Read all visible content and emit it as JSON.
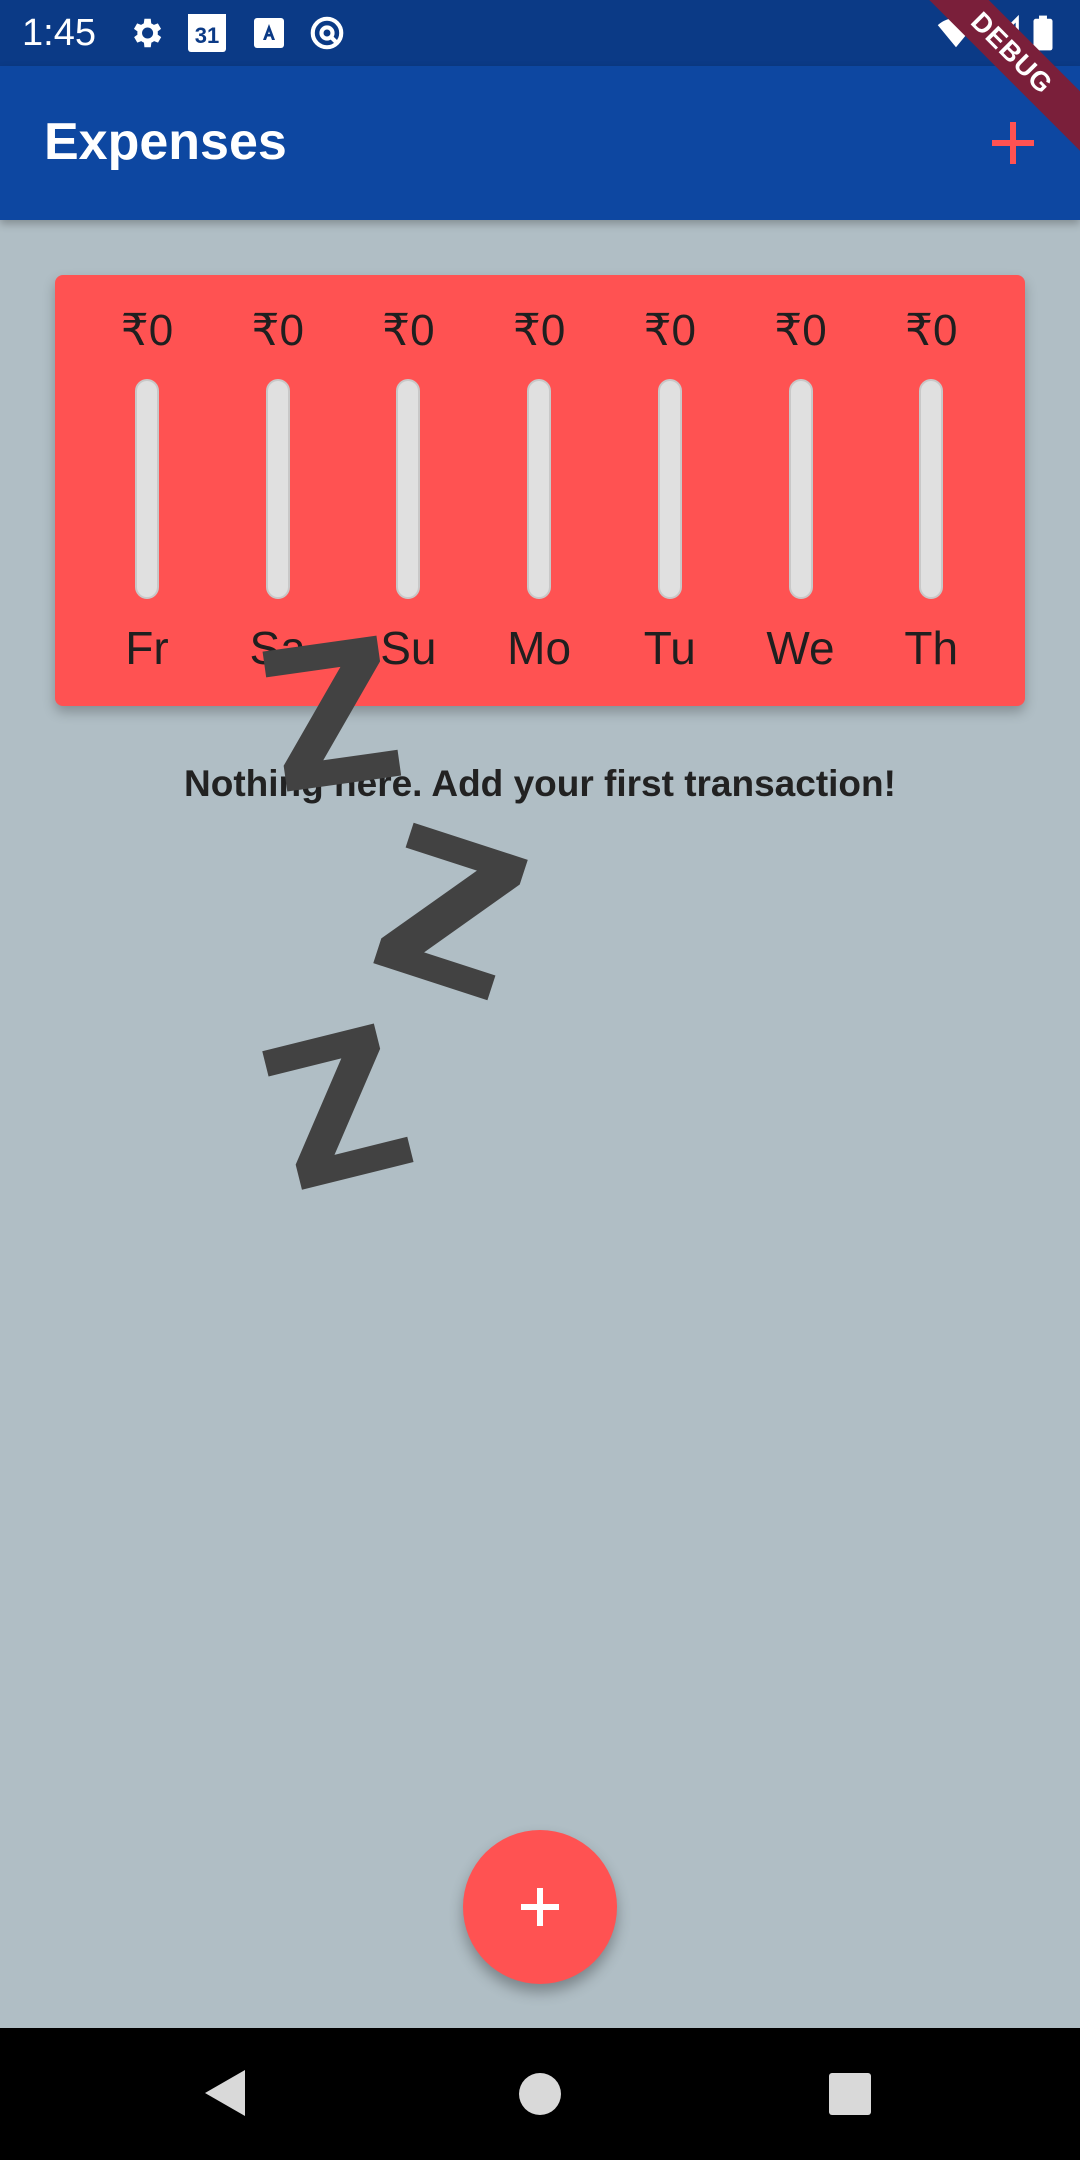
{
  "status_bar": {
    "time": "1:45",
    "calendar_day": "31",
    "icons": [
      "settings-icon",
      "calendar-icon",
      "font-icon",
      "circle-q-icon",
      "wifi-icon",
      "signal-icon",
      "battery-icon"
    ]
  },
  "app_bar": {
    "title": "Expenses",
    "add_icon": "plus-icon"
  },
  "debug_banner": "DEBUG",
  "chart": {
    "bars": [
      {
        "day": "Fr",
        "amount": "₹0",
        "fraction": 0
      },
      {
        "day": "Sa",
        "amount": "₹0",
        "fraction": 0
      },
      {
        "day": "Su",
        "amount": "₹0",
        "fraction": 0
      },
      {
        "day": "Mo",
        "amount": "₹0",
        "fraction": 0
      },
      {
        "day": "Tu",
        "amount": "₹0",
        "fraction": 0
      },
      {
        "day": "We",
        "amount": "₹0",
        "fraction": 0
      },
      {
        "day": "Th",
        "amount": "₹0",
        "fraction": 0
      }
    ]
  },
  "empty_state": {
    "message": "Nothing here. Add your first transaction!",
    "illustration": "Z Z Z"
  },
  "fab": {
    "icon": "plus-icon"
  },
  "nav_bar": {
    "icons": [
      "back-icon",
      "home-icon",
      "recents-icon"
    ]
  },
  "colors": {
    "status_bar": "#0b3a86",
    "app_bar": "#0d47a1",
    "background": "#b0bec5",
    "accent": "#ff5252",
    "debug": "#7a1f3a"
  }
}
